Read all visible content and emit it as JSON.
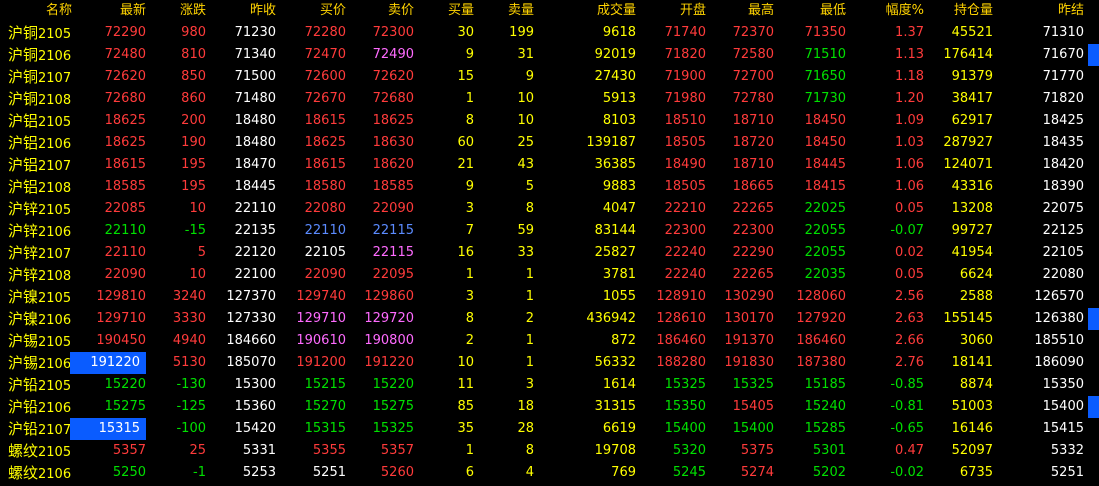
{
  "headers": {
    "name": "名称",
    "last": "最新",
    "chg": "涨跌",
    "prevc": "昨收",
    "bid": "买价",
    "ask": "卖价",
    "bvol": "买量",
    "avol": "卖量",
    "vol": "成交量",
    "open": "开盘",
    "high": "最高",
    "low": "最低",
    "pct": "幅度%",
    "oi": "持仓量",
    "prevs": "昨结"
  },
  "rows": [
    {
      "name": "沪铜",
      "code": "2105",
      "last": "72290",
      "chg": "980",
      "prevc": "71230",
      "bid": "72280",
      "ask": "72300",
      "bvol": "30",
      "avol": "199",
      "vol": "9618",
      "open": "71740",
      "high": "72370",
      "low": "71350",
      "pct": "1.37",
      "oi": "45521",
      "prevs": "71310"
    },
    {
      "name": "沪铜",
      "code": "2106",
      "last": "72480",
      "chg": "810",
      "prevc": "71340",
      "bid": "72470",
      "ask": "72490",
      "bvol": "9",
      "avol": "31",
      "vol": "92019",
      "open": "71820",
      "high": "72580",
      "low": "71510",
      "pct": "1.13",
      "oi": "176414",
      "prevs": "71670"
    },
    {
      "name": "沪铜",
      "code": "2107",
      "last": "72620",
      "chg": "850",
      "prevc": "71500",
      "bid": "72600",
      "ask": "72620",
      "bvol": "15",
      "avol": "9",
      "vol": "27430",
      "open": "71900",
      "high": "72700",
      "low": "71650",
      "pct": "1.18",
      "oi": "91379",
      "prevs": "71770"
    },
    {
      "name": "沪铜",
      "code": "2108",
      "last": "72680",
      "chg": "860",
      "prevc": "71480",
      "bid": "72670",
      "ask": "72680",
      "bvol": "1",
      "avol": "10",
      "vol": "5913",
      "open": "71980",
      "high": "72780",
      "low": "71730",
      "pct": "1.20",
      "oi": "38417",
      "prevs": "71820"
    },
    {
      "name": "沪铝",
      "code": "2105",
      "last": "18625",
      "chg": "200",
      "prevc": "18480",
      "bid": "18615",
      "ask": "18625",
      "bvol": "8",
      "avol": "10",
      "vol": "8103",
      "open": "18510",
      "high": "18710",
      "low": "18450",
      "pct": "1.09",
      "oi": "62917",
      "prevs": "18425"
    },
    {
      "name": "沪铝",
      "code": "2106",
      "last": "18625",
      "chg": "190",
      "prevc": "18480",
      "bid": "18625",
      "ask": "18630",
      "bvol": "60",
      "avol": "25",
      "vol": "139187",
      "open": "18505",
      "high": "18720",
      "low": "18450",
      "pct": "1.03",
      "oi": "287927",
      "prevs": "18435"
    },
    {
      "name": "沪铝",
      "code": "2107",
      "last": "18615",
      "chg": "195",
      "prevc": "18470",
      "bid": "18615",
      "ask": "18620",
      "bvol": "21",
      "avol": "43",
      "vol": "36385",
      "open": "18490",
      "high": "18710",
      "low": "18445",
      "pct": "1.06",
      "oi": "124071",
      "prevs": "18420"
    },
    {
      "name": "沪铝",
      "code": "2108",
      "last": "18585",
      "chg": "195",
      "prevc": "18445",
      "bid": "18580",
      "ask": "18585",
      "bvol": "9",
      "avol": "5",
      "vol": "9883",
      "open": "18505",
      "high": "18665",
      "low": "18415",
      "pct": "1.06",
      "oi": "43316",
      "prevs": "18390"
    },
    {
      "name": "沪锌",
      "code": "2105",
      "last": "22085",
      "chg": "10",
      "prevc": "22110",
      "bid": "22080",
      "ask": "22090",
      "bvol": "3",
      "avol": "8",
      "vol": "4047",
      "open": "22210",
      "high": "22265",
      "low": "22025",
      "pct": "0.05",
      "oi": "13208",
      "prevs": "22075"
    },
    {
      "name": "沪锌",
      "code": "2106",
      "last": "22110",
      "chg": "-15",
      "prevc": "22135",
      "bid": "22110",
      "ask": "22115",
      "bvol": "7",
      "avol": "59",
      "vol": "83144",
      "open": "22300",
      "high": "22300",
      "low": "22055",
      "pct": "-0.07",
      "oi": "99727",
      "prevs": "22125"
    },
    {
      "name": "沪锌",
      "code": "2107",
      "last": "22110",
      "chg": "5",
      "prevc": "22120",
      "bid": "22105",
      "ask": "22115",
      "bvol": "16",
      "avol": "33",
      "vol": "25827",
      "open": "22240",
      "high": "22290",
      "low": "22055",
      "pct": "0.02",
      "oi": "41954",
      "prevs": "22105"
    },
    {
      "name": "沪锌",
      "code": "2108",
      "last": "22090",
      "chg": "10",
      "prevc": "22100",
      "bid": "22090",
      "ask": "22095",
      "bvol": "1",
      "avol": "1",
      "vol": "3781",
      "open": "22240",
      "high": "22265",
      "low": "22035",
      "pct": "0.05",
      "oi": "6624",
      "prevs": "22080"
    },
    {
      "name": "沪镍",
      "code": "2105",
      "last": "129810",
      "chg": "3240",
      "prevc": "127370",
      "bid": "129740",
      "ask": "129860",
      "bvol": "3",
      "avol": "1",
      "vol": "1055",
      "open": "128910",
      "high": "130290",
      "low": "128060",
      "pct": "2.56",
      "oi": "2588",
      "prevs": "126570"
    },
    {
      "name": "沪镍",
      "code": "2106",
      "last": "129710",
      "chg": "3330",
      "prevc": "127330",
      "bid": "129710",
      "ask": "129720",
      "bvol": "8",
      "avol": "2",
      "vol": "436942",
      "open": "128610",
      "high": "130170",
      "low": "127920",
      "pct": "2.63",
      "oi": "155145",
      "prevs": "126380"
    },
    {
      "name": "沪锡",
      "code": "2105",
      "last": "190450",
      "chg": "4940",
      "prevc": "184660",
      "bid": "190610",
      "ask": "190800",
      "bvol": "2",
      "avol": "1",
      "vol": "872",
      "open": "186460",
      "high": "191370",
      "low": "186460",
      "pct": "2.66",
      "oi": "3060",
      "prevs": "185510"
    },
    {
      "name": "沪锡",
      "code": "2106",
      "last": "191220",
      "chg": "5130",
      "prevc": "185070",
      "bid": "191200",
      "ask": "191220",
      "bvol": "10",
      "avol": "1",
      "vol": "56332",
      "open": "188280",
      "high": "191830",
      "low": "187380",
      "pct": "2.76",
      "oi": "18141",
      "prevs": "186090"
    },
    {
      "name": "沪铅",
      "code": "2105",
      "last": "15220",
      "chg": "-130",
      "prevc": "15300",
      "bid": "15215",
      "ask": "15220",
      "bvol": "11",
      "avol": "3",
      "vol": "1614",
      "open": "15325",
      "high": "15325",
      "low": "15185",
      "pct": "-0.85",
      "oi": "8874",
      "prevs": "15350"
    },
    {
      "name": "沪铅",
      "code": "2106",
      "last": "15275",
      "chg": "-125",
      "prevc": "15360",
      "bid": "15270",
      "ask": "15275",
      "bvol": "85",
      "avol": "18",
      "vol": "31315",
      "open": "15350",
      "high": "15405",
      "low": "15240",
      "pct": "-0.81",
      "oi": "51003",
      "prevs": "15400"
    },
    {
      "name": "沪铅",
      "code": "2107",
      "last": "15315",
      "chg": "-100",
      "prevc": "15420",
      "bid": "15315",
      "ask": "15325",
      "bvol": "35",
      "avol": "28",
      "vol": "6619",
      "open": "15400",
      "high": "15400",
      "low": "15285",
      "pct": "-0.65",
      "oi": "16146",
      "prevs": "15415"
    },
    {
      "name": "螺纹",
      "code": "2105",
      "last": "5357",
      "chg": "25",
      "prevc": "5331",
      "bid": "5355",
      "ask": "5357",
      "bvol": "1",
      "avol": "8",
      "vol": "19708",
      "open": "5320",
      "high": "5375",
      "low": "5301",
      "pct": "0.47",
      "oi": "52097",
      "prevs": "5332"
    },
    {
      "name": "螺纹",
      "code": "2106",
      "last": "5250",
      "chg": "-1",
      "prevc": "5253",
      "bid": "5251",
      "ask": "5260",
      "bvol": "6",
      "avol": "4",
      "vol": "769",
      "open": "5245",
      "high": "5274",
      "low": "5202",
      "pct": "-0.02",
      "oi": "6735",
      "prevs": "5251"
    }
  ],
  "colors": {
    "up": "#ff3b3b",
    "down": "#00e000",
    "flat": "#ffffff",
    "volume": "#ffff00",
    "highlight": "#0a5cff"
  }
}
